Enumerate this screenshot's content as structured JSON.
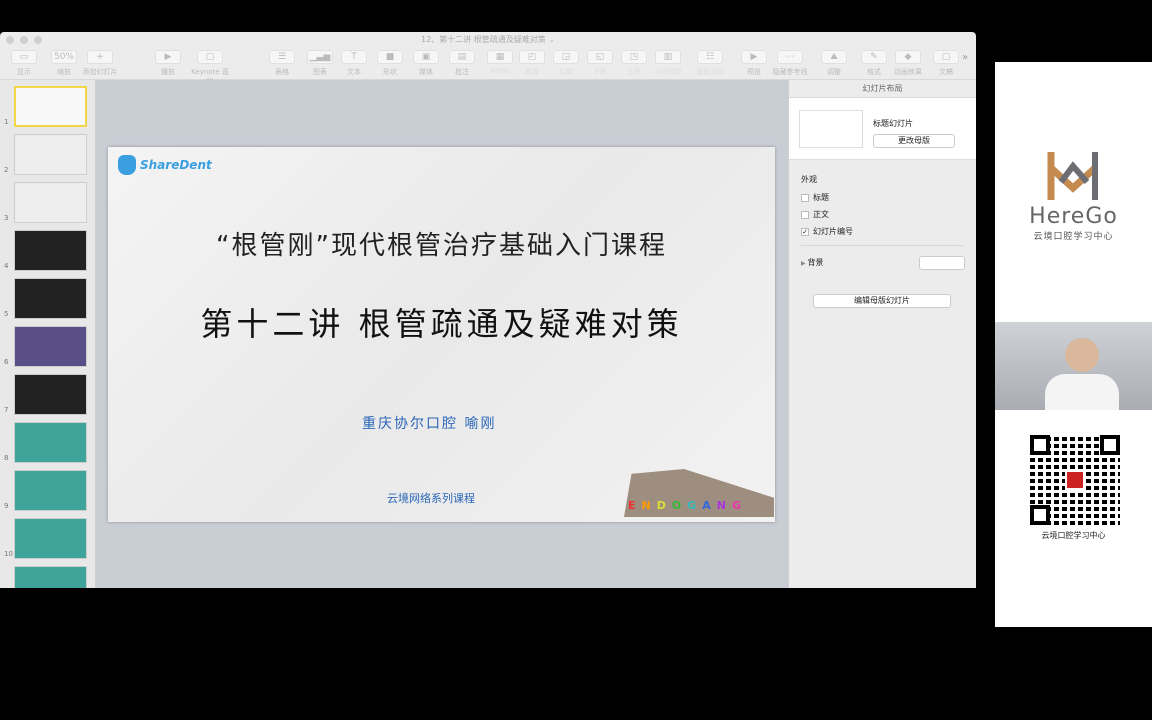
{
  "window": {
    "title": "12、第十二讲 根管疏通及疑难对策"
  },
  "toolbar": {
    "items": [
      {
        "label": "显示",
        "icon": "view-icon",
        "sym": "▭"
      },
      {
        "label": "缩放",
        "icon": "zoom-icon",
        "sym": "50%"
      },
      {
        "label": "添加幻灯片",
        "icon": "plus-icon",
        "sym": "+"
      },
      {
        "label": "播放",
        "icon": "play-icon",
        "sym": "▶"
      },
      {
        "label": "Keynote 直播",
        "icon": "live-icon",
        "sym": "▢"
      },
      {
        "label": "表格",
        "icon": "table-icon",
        "sym": "☰"
      },
      {
        "label": "图表",
        "icon": "chart-icon",
        "sym": "▁▃▅"
      },
      {
        "label": "文本",
        "icon": "text-icon",
        "sym": "T"
      },
      {
        "label": "形状",
        "icon": "shape-icon",
        "sym": "■"
      },
      {
        "label": "媒体",
        "icon": "media-icon",
        "sym": "▣"
      },
      {
        "label": "批注",
        "icon": "comment-icon",
        "sym": "▤"
      },
      {
        "label": "Alpha",
        "icon": "alpha-icon",
        "sym": "▦"
      },
      {
        "label": "前置",
        "icon": "front-icon",
        "sym": "◰"
      },
      {
        "label": "后置",
        "icon": "back-icon",
        "sym": "◲"
      },
      {
        "label": "下移",
        "icon": "down-icon",
        "sym": "◱"
      },
      {
        "label": "上移",
        "icon": "up-icon",
        "sym": "◳"
      },
      {
        "label": "平行间距",
        "icon": "hspace-icon",
        "sym": "▥"
      },
      {
        "label": "垂直间距",
        "icon": "vspace-icon",
        "sym": "☷"
      },
      {
        "label": "预览",
        "icon": "preview-icon",
        "sym": "▶"
      },
      {
        "label": "隐藏参考线",
        "icon": "guides-icon",
        "sym": "⋯"
      },
      {
        "label": "调整",
        "icon": "adjust-icon",
        "sym": "⛰"
      },
      {
        "label": "格式",
        "icon": "format-icon",
        "sym": "✎"
      },
      {
        "label": "动画效果",
        "icon": "animate-icon",
        "sym": "◆"
      },
      {
        "label": "文稿",
        "icon": "document-icon",
        "sym": "▢"
      }
    ],
    "more": "»"
  },
  "slides": [
    "1",
    "2",
    "3",
    "4",
    "5",
    "6",
    "7",
    "8",
    "9",
    "10"
  ],
  "slide": {
    "logo": "ShareDent",
    "title1": "“根管刚”现代根管治疗基础入门课程",
    "title2": "第十二讲 根管疏通及疑难对策",
    "author": "重庆协尔口腔 喻刚",
    "series": "云境网络系列课程",
    "endo_logo": "ENDOGANG"
  },
  "inspector": {
    "header": "幻灯片布局",
    "master_name": "标题幻灯片",
    "change_master": "更改母版",
    "appearance": "外观",
    "checks": [
      {
        "label": "标题",
        "checked": false
      },
      {
        "label": "正文",
        "checked": false
      },
      {
        "label": "幻灯片编号",
        "checked": true
      }
    ],
    "background": "背景",
    "edit_master": "编辑母版幻灯片"
  },
  "brand": {
    "name": "HereGo",
    "subtitle": "云境口腔学习中心",
    "qr_caption": "云境口腔学习中心"
  }
}
